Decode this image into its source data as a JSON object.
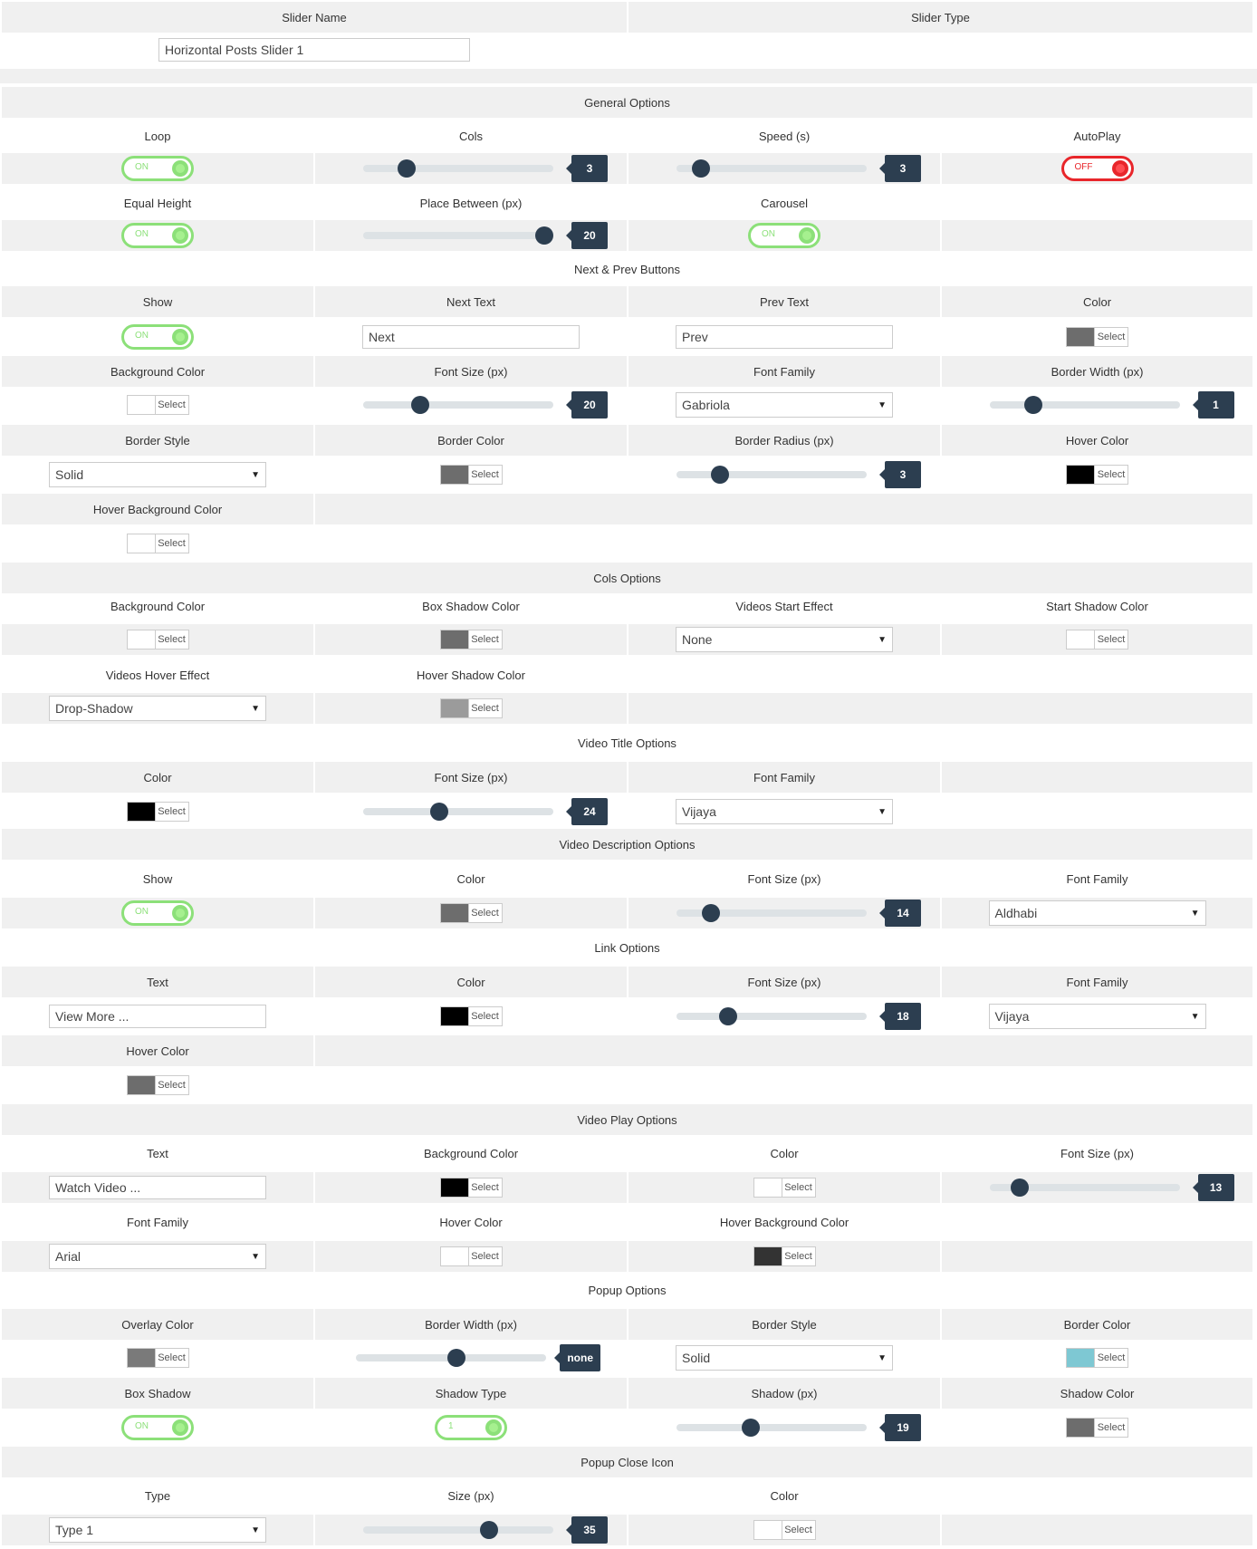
{
  "top": {
    "slider_name_label": "Slider Name",
    "slider_type_label": "Slider Type",
    "slider_name_value": "Horizontal Posts Slider 1"
  },
  "common": {
    "select_label": "Select",
    "dropdown_arrow": "▼"
  },
  "colors": {
    "grey": "#6d6d6d",
    "black": "#000000",
    "white": "#ffffff",
    "lightgrey": "#9b9b9b",
    "dark": "#333333",
    "mid": "#7a7a7a",
    "teal": "#7ec8d3",
    "toggle_on": "#8ce079",
    "toggle_off": "#e8262b",
    "slider_value_bg": "#2c3e50"
  },
  "general": {
    "title": "General Options",
    "loop": {
      "label": "Loop",
      "state": "ON"
    },
    "cols": {
      "label": "Cols",
      "value": "3",
      "fraction": 0.23
    },
    "speed": {
      "label": "Speed (s)",
      "value": "3",
      "fraction": 0.13
    },
    "autoplay": {
      "label": "AutoPlay",
      "state": "OFF"
    },
    "equal_height": {
      "label": "Equal Height",
      "state": "ON"
    },
    "place_between": {
      "label": "Place Between (px)",
      "value": "20",
      "fraction": 0.95
    },
    "carousel": {
      "label": "Carousel",
      "state": "ON"
    }
  },
  "buttons": {
    "title": "Next & Prev Buttons",
    "show": {
      "label": "Show",
      "state": "ON"
    },
    "next_text": {
      "label": "Next Text",
      "value": "Next"
    },
    "prev_text": {
      "label": "Prev Text",
      "value": "Prev"
    },
    "color": {
      "label": "Color"
    },
    "bg_color": {
      "label": "Background Color"
    },
    "font_size": {
      "label": "Font Size (px)",
      "value": "20",
      "fraction": 0.3
    },
    "font_family": {
      "label": "Font Family",
      "value": "Gabriola"
    },
    "border_width": {
      "label": "Border Width (px)",
      "value": "1",
      "fraction": 0.23
    },
    "border_style": {
      "label": "Border Style",
      "value": "Solid"
    },
    "border_color": {
      "label": "Border Color"
    },
    "border_radius": {
      "label": "Border Radius (px)",
      "value": "3",
      "fraction": 0.23
    },
    "hover_color": {
      "label": "Hover Color"
    },
    "hover_bg_color": {
      "label": "Hover Background Color"
    }
  },
  "cols": {
    "title": "Cols Options",
    "bg_color": {
      "label": "Background Color"
    },
    "box_shadow_color": {
      "label": "Box Shadow Color"
    },
    "start_effect": {
      "label": "Videos Start Effect",
      "value": "None"
    },
    "start_shadow_color": {
      "label": "Start Shadow Color"
    },
    "hover_effect": {
      "label": "Videos Hover Effect",
      "value": "Drop-Shadow"
    },
    "hover_shadow_color": {
      "label": "Hover Shadow Color"
    }
  },
  "video_title": {
    "title": "Video Title Options",
    "color": {
      "label": "Color"
    },
    "font_size": {
      "label": "Font Size (px)",
      "value": "24",
      "fraction": 0.4
    },
    "font_family": {
      "label": "Font Family",
      "value": "Vijaya"
    }
  },
  "video_desc": {
    "title": "Video Description Options",
    "show": {
      "label": "Show",
      "state": "ON"
    },
    "color": {
      "label": "Color"
    },
    "font_size": {
      "label": "Font Size (px)",
      "value": "14",
      "fraction": 0.18
    },
    "font_family": {
      "label": "Font Family",
      "value": "Aldhabi"
    }
  },
  "link": {
    "title": "Link Options",
    "text": {
      "label": "Text",
      "value": "View More ..."
    },
    "color": {
      "label": "Color"
    },
    "font_size": {
      "label": "Font Size (px)",
      "value": "18",
      "fraction": 0.27
    },
    "font_family": {
      "label": "Font Family",
      "value": "Vijaya"
    },
    "hover_color": {
      "label": "Hover Color"
    }
  },
  "play": {
    "title": "Video Play Options",
    "text": {
      "label": "Text",
      "value": "Watch Video ..."
    },
    "bg_color": {
      "label": "Background Color"
    },
    "color": {
      "label": "Color"
    },
    "font_size": {
      "label": "Font Size (px)",
      "value": "13",
      "fraction": 0.16
    },
    "font_family": {
      "label": "Font Family",
      "value": "Arial"
    },
    "hover_color": {
      "label": "Hover Color"
    },
    "hover_bg_color": {
      "label": "Hover Background Color"
    }
  },
  "popup": {
    "title": "Popup Options",
    "overlay_color": {
      "label": "Overlay Color"
    },
    "border_width": {
      "label": "Border Width (px)",
      "value": "none",
      "fraction": 0.53
    },
    "border_style": {
      "label": "Border Style",
      "value": "Solid"
    },
    "border_color": {
      "label": "Border Color"
    },
    "box_shadow": {
      "label": "Box Shadow",
      "state": "ON"
    },
    "shadow_type": {
      "label": "Shadow Type",
      "state": "1"
    },
    "shadow_px": {
      "label": "Shadow (px)",
      "value": "19",
      "fraction": 0.39
    },
    "shadow_color": {
      "label": "Shadow Color"
    }
  },
  "close_icon": {
    "title": "Popup Close Icon",
    "type": {
      "label": "Type",
      "value": "Type 1"
    },
    "size": {
      "label": "Size (px)",
      "value": "35",
      "fraction": 0.66
    },
    "color": {
      "label": "Color"
    }
  }
}
